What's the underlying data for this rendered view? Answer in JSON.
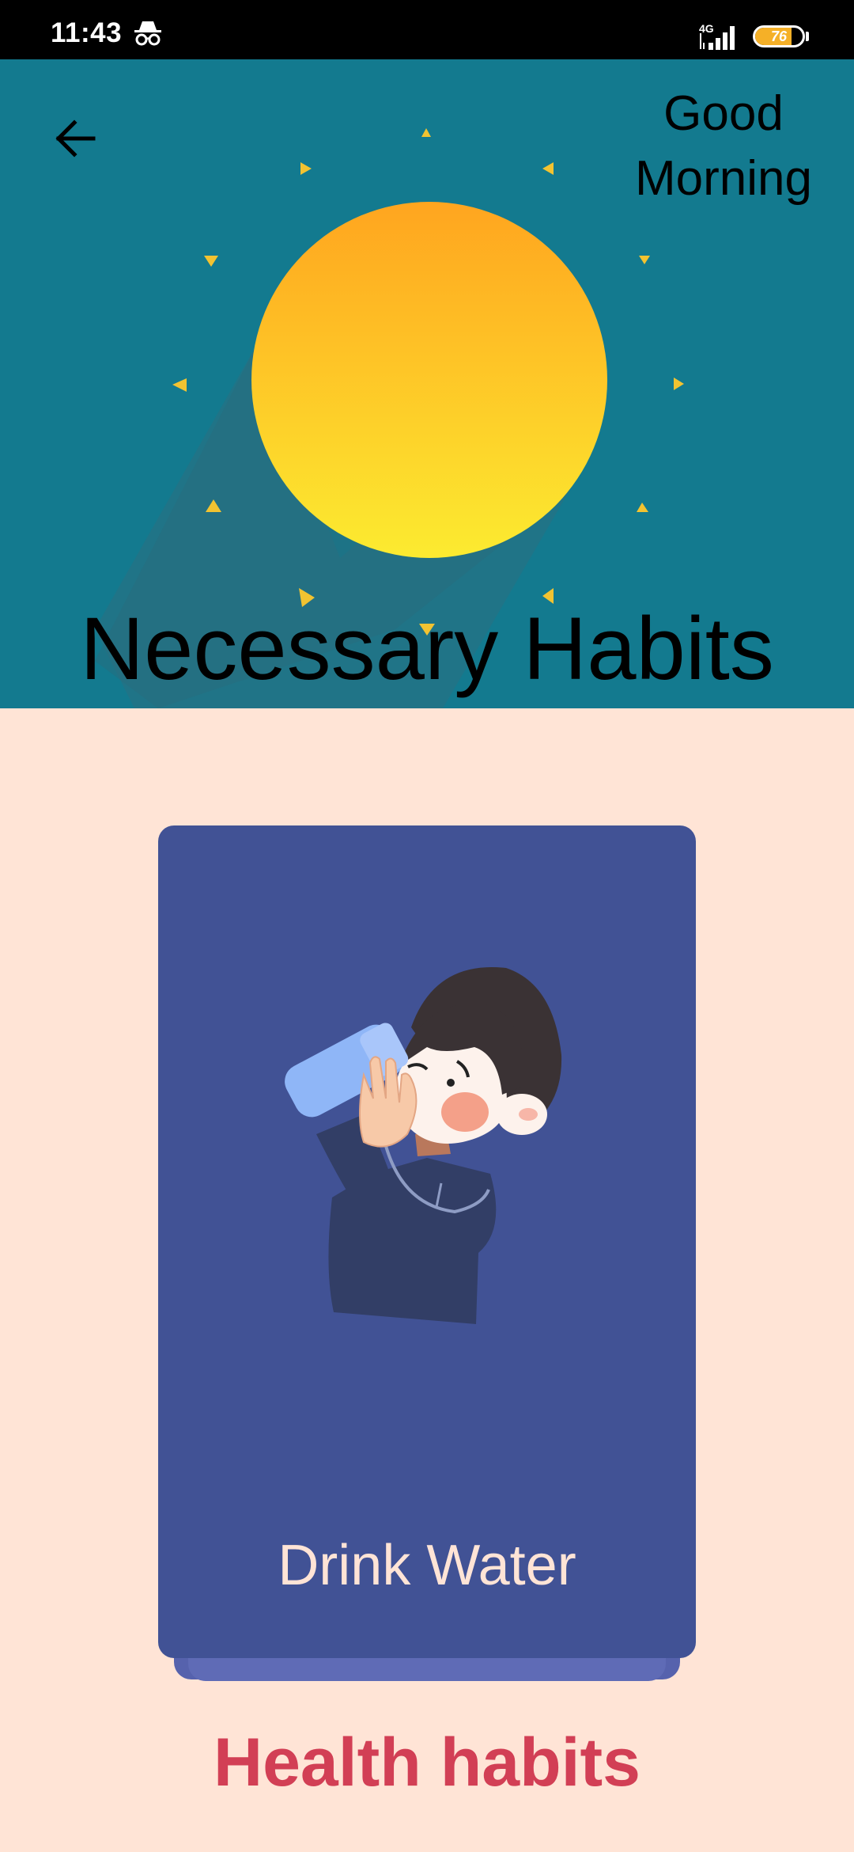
{
  "status_bar": {
    "time": "11:43",
    "network": "4G",
    "battery_level": "76",
    "battery_fraction": 0.76
  },
  "header": {
    "greeting": "Good Morning",
    "title": "Necessary Habits",
    "colors": {
      "background": "#137A8F",
      "sun_top": "#FFA51F",
      "sun_bottom": "#FCEB30"
    }
  },
  "card": {
    "label": "Drink Water",
    "illustration": "boy-drinking-water-illustration",
    "colors": {
      "background": "#415295",
      "label": "#FFE4D6"
    }
  },
  "footer": {
    "category": "Health habits",
    "color": "#D23F55"
  },
  "page_background": "#FFE4D6",
  "icons": {
    "back": "arrow-left-icon",
    "incognito": "incognito-icon",
    "signal": "signal-icon",
    "battery": "battery-icon"
  }
}
